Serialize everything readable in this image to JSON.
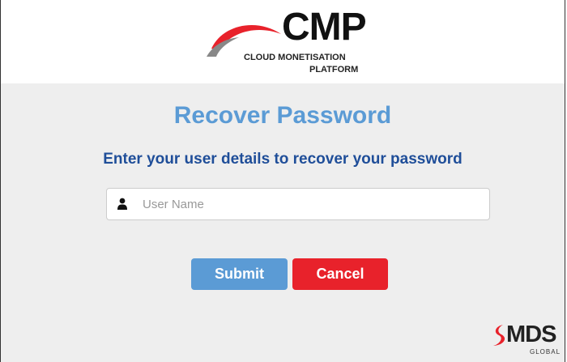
{
  "logo": {
    "name": "CMP",
    "subtitle_line1": "CLOUD MONETISATION",
    "subtitle_line2": "PLATFORM"
  },
  "page": {
    "title": "Recover Password",
    "subtitle": "Enter your user details to recover your password"
  },
  "form": {
    "username": {
      "placeholder": "User Name",
      "value": "",
      "icon": "user-icon"
    },
    "submit_label": "Submit",
    "cancel_label": "Cancel"
  },
  "footer": {
    "brand": "MDS",
    "brand_sub": "GLOBAL"
  },
  "colors": {
    "title": "#5b9bd5",
    "subtitle": "#1f4e99",
    "submit": "#5b9bd5",
    "cancel": "#e8222b",
    "logo_red": "#e8222b",
    "logo_grey": "#888888"
  }
}
